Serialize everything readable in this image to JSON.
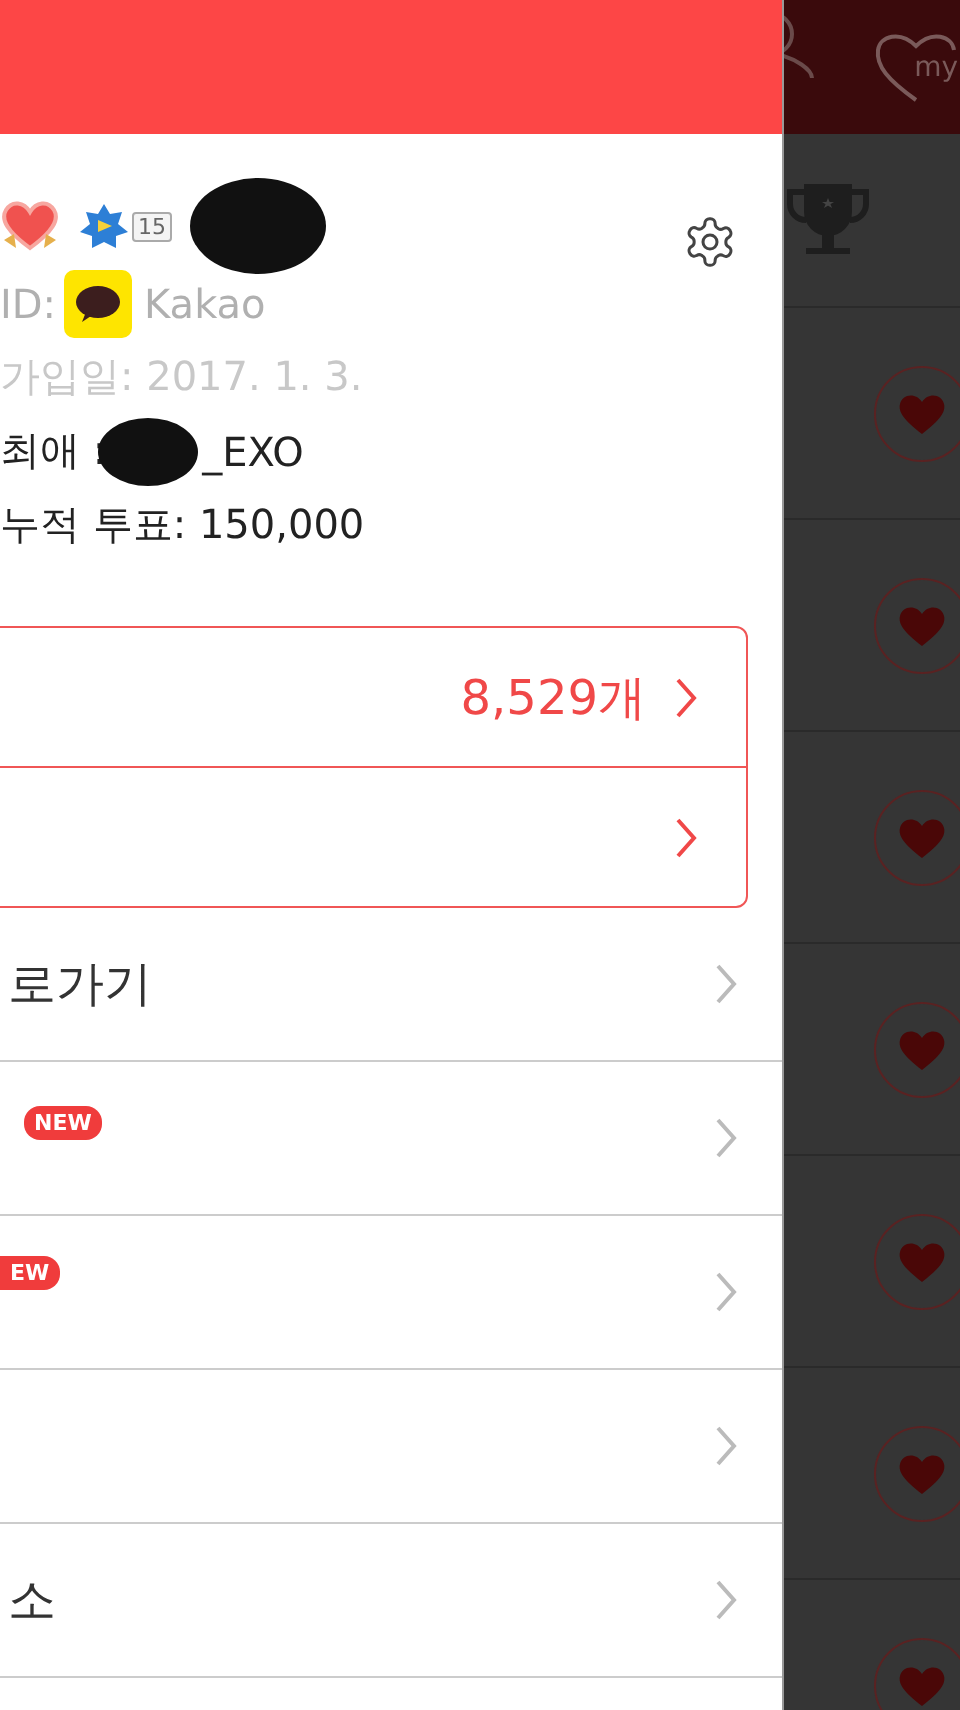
{
  "top_bar": {
    "my_label": "my"
  },
  "profile": {
    "level_badge": "15",
    "id_label": "ID:",
    "provider": "Kakao",
    "joined": "가입일: 2017. 1. 3.",
    "favorite_prefix": "최애 :",
    "favorite_suffix": "_EXO",
    "total_votes": "누적 투표: 150,000"
  },
  "summary_rows": [
    {
      "kind": "count",
      "value": "8,529개"
    },
    {
      "kind": "link"
    }
  ],
  "menu": [
    {
      "kind": "text",
      "label": "로가기"
    },
    {
      "kind": "badge",
      "badge": "NEW"
    },
    {
      "kind": "cut_badge",
      "badge": "EW"
    },
    {
      "kind": "blank"
    },
    {
      "kind": "text",
      "label": "소"
    }
  ],
  "ranking_rows": [
    {
      "kind": "trophy"
    },
    {
      "kind": "heart"
    },
    {
      "kind": "heart"
    },
    {
      "kind": "heart"
    },
    {
      "kind": "heart"
    },
    {
      "kind": "heart"
    },
    {
      "kind": "heart"
    },
    {
      "kind": "heart"
    }
  ]
}
